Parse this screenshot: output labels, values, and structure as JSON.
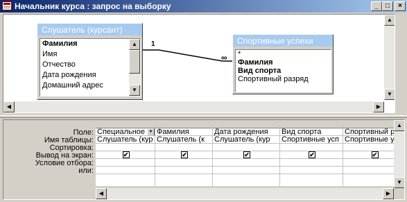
{
  "window": {
    "title": "Начальник курса : запрос на выборку"
  },
  "title_buttons": {
    "minimize": "_",
    "maximize": "□",
    "close": "×"
  },
  "tables": [
    {
      "caption": "Слушатель (курсант)",
      "fields": [
        "Фамилия",
        "Имя",
        "Отчество",
        "Дата рождения",
        "Домашний адрес"
      ],
      "key_index": 0
    },
    {
      "caption": "Спортивные успехи",
      "fields": [
        "*",
        "Фамилия",
        "Вид спорта",
        "Спортивный разряд"
      ],
      "key_index": 1
    }
  ],
  "relationship": {
    "one_label": "1",
    "many_label": "∞"
  },
  "grid": {
    "row_labels": [
      "Поле:",
      "Имя таблицы:",
      "Сортировка:",
      "Вывод на экран:",
      "Условие отбора:",
      "или:"
    ],
    "columns": [
      {
        "field": "Специальное з",
        "table": "Слушатель (кур",
        "show": true,
        "has_dropdown": true
      },
      {
        "field": "Фамилия",
        "table": "Слушатель (к",
        "show": true,
        "has_dropdown": false
      },
      {
        "field": "Дата рождения",
        "table": "Слушатель (кур",
        "show": true,
        "has_dropdown": false
      },
      {
        "field": "Вид спорта",
        "table": "Спортивные усп",
        "show": true,
        "has_dropdown": false
      },
      {
        "field": "Спортивный разр",
        "table": "Спортивные успе",
        "show": true,
        "has_dropdown": false
      }
    ]
  },
  "glyphs": {
    "check": "✔",
    "up": "▲",
    "down": "▼",
    "left": "◀",
    "right": "▶"
  }
}
